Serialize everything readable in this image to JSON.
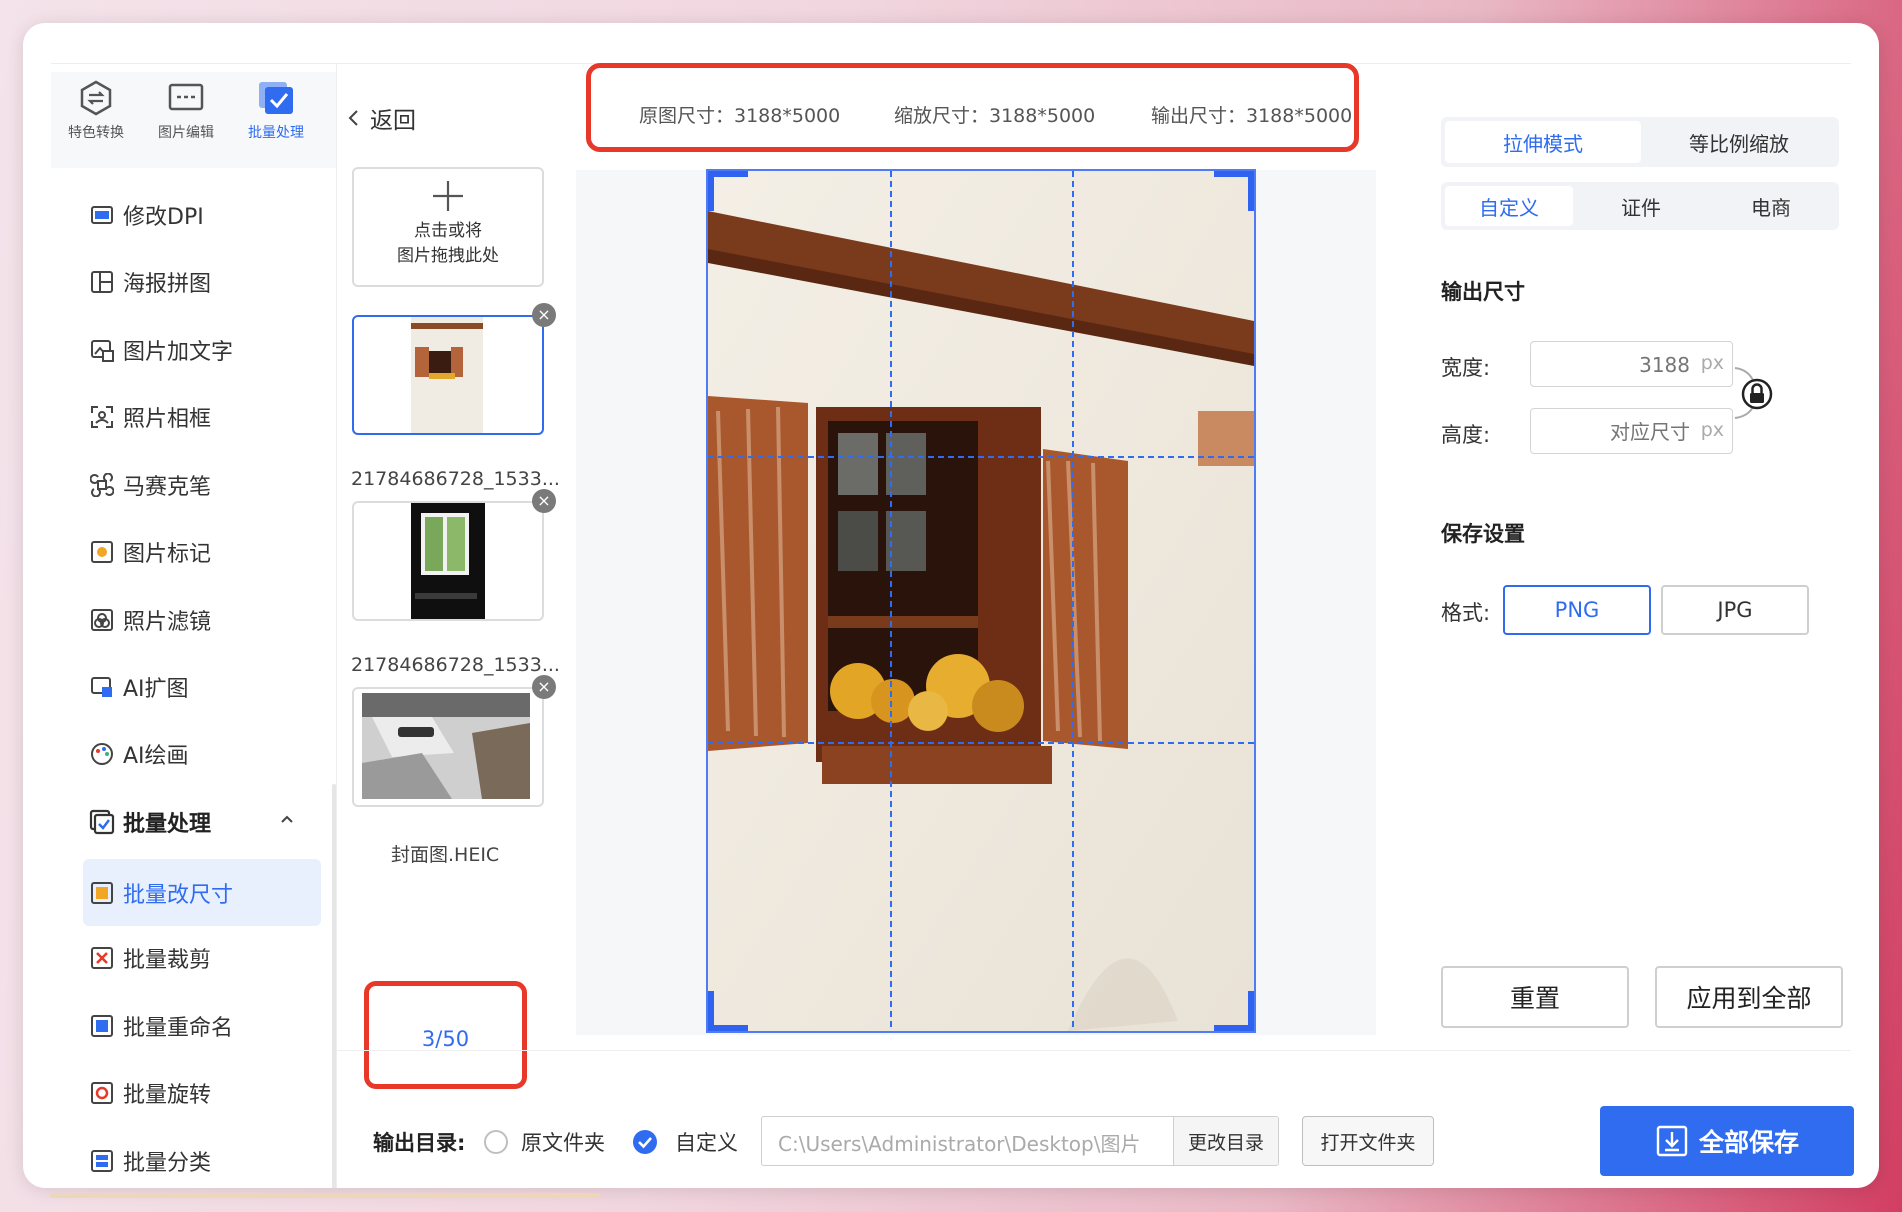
{
  "colors": {
    "accent": "#2f6cf0",
    "highlight_box": "#e8382a",
    "guide_lines": "#2f6cf0"
  },
  "topnav": [
    {
      "label": "特色转换",
      "icon": "convert-icon",
      "active": false
    },
    {
      "label": "图片编辑",
      "icon": "image-edit-icon",
      "active": false
    },
    {
      "label": "批量处理",
      "icon": "batch-icon",
      "active": true
    }
  ],
  "menu": [
    {
      "label": "修改DPI",
      "icon": "hd-icon"
    },
    {
      "label": "海报拼图",
      "icon": "collage-icon"
    },
    {
      "label": "图片加文字",
      "icon": "image-text-icon"
    },
    {
      "label": "照片相框",
      "icon": "frame-icon"
    },
    {
      "label": "马赛克笔",
      "icon": "mosaic-icon"
    },
    {
      "label": "图片标记",
      "icon": "mark-icon"
    },
    {
      "label": "照片滤镜",
      "icon": "filter-icon"
    },
    {
      "label": "AI扩图",
      "icon": "ai-expand-icon"
    },
    {
      "label": "AI绘画",
      "icon": "palette-icon"
    },
    {
      "label": "批量处理",
      "icon": "batch-group-icon",
      "group": true
    },
    {
      "label": "批量改尺寸",
      "icon": "resize-icon",
      "active": true
    },
    {
      "label": "批量裁剪",
      "icon": "crop-icon"
    },
    {
      "label": "批量重命名",
      "icon": "rename-icon"
    },
    {
      "label": "批量旋转",
      "icon": "rotate-icon"
    },
    {
      "label": "批量分类",
      "icon": "classify-icon"
    }
  ],
  "back_label": "返回",
  "upload": {
    "line1": "点击或将",
    "line2": "图片拖拽此处"
  },
  "thumbnails": [
    {
      "name": "21784686728_1533..."
    },
    {
      "name": "21784686728_1533..."
    },
    {
      "name": "封面图.HEIC"
    }
  ],
  "close_glyph": "×",
  "pager": "3/50",
  "info": {
    "original": "原图尺寸：3188*5000",
    "scaled": "缩放尺寸：3188*5000",
    "output": "输出尺寸：3188*5000"
  },
  "mode_tabs": [
    {
      "label": "拉伸模式",
      "active": true
    },
    {
      "label": "等比例缩放",
      "active": false
    }
  ],
  "preset_tabs": [
    {
      "label": "自定义",
      "active": true
    },
    {
      "label": "证件",
      "active": false
    },
    {
      "label": "电商",
      "active": false
    }
  ],
  "output_size": {
    "title": "输出尺寸",
    "width_label": "宽度:",
    "width_placeholder": "3188",
    "height_label": "高度:",
    "height_placeholder": "对应尺寸",
    "unit": "px"
  },
  "save_settings": {
    "title": "保存设置",
    "format_label": "格式:",
    "formats": [
      {
        "label": "PNG",
        "active": true
      },
      {
        "label": "JPG",
        "active": false
      }
    ]
  },
  "reset_label": "重置",
  "apply_all_label": "应用到全部",
  "bottom": {
    "output_dir_label": "输出目录:",
    "option_original": "原文件夹",
    "option_custom": "自定义",
    "path": "C:\\Users\\Administrator\\Desktop\\图片",
    "change_dir": "更改目录",
    "open_folder": "打开文件夹",
    "save_all": "全部保存"
  }
}
